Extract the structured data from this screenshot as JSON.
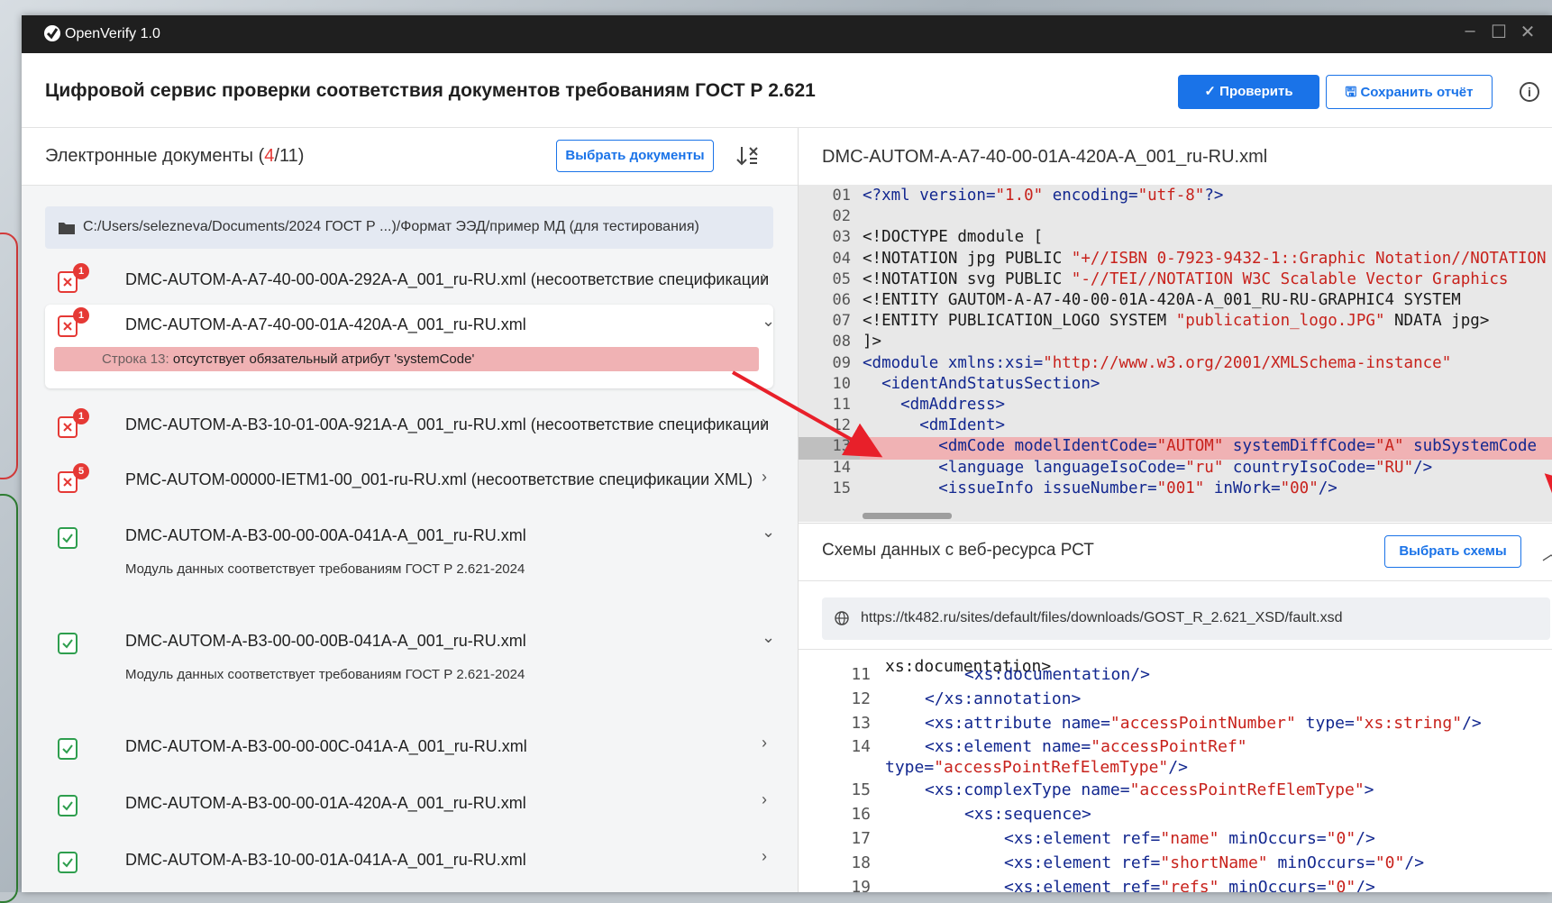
{
  "window": {
    "app_title": "OpenVerify 1.0",
    "controls": [
      "–",
      "☐",
      "✕"
    ]
  },
  "header": {
    "title": "Цифровой сервис проверки соответствия документов требованиям ГОСТ Р 2.621",
    "check_button": "Проверить",
    "save_button": "Сохранить отчёт",
    "info_icon": "i"
  },
  "documents_panel": {
    "title": "Электронные документы",
    "count_open": "(",
    "count_error": "4",
    "count_total": "/11)",
    "select_button": "Выбрать документы",
    "path": "C:/Users/selezneva/Documents/2024 ГОСТ Р ...)/Формат ЭЭД/пример МД (для тестирования)",
    "items": [
      {
        "status": "error",
        "badge": "1",
        "name": "DMC-AUTOM-A-A7-40-00-00A-292A-A_001_ru-RU.xml (несоответствие спецификации",
        "chevron": "›"
      },
      {
        "status": "error",
        "badge": "1",
        "name": "DMC-AUTOM-A-A7-40-00-01A-420A-A_001_ru-RU.xml",
        "chevron": "⌄",
        "error_label": "Строка 13:",
        "error_text": "отсутствует обязательный атрибут 'systemCode'"
      },
      {
        "status": "error",
        "badge": "1",
        "name": "DMC-AUTOM-A-B3-10-01-00A-921A-A_001_ru-RU.xml (несоответствие спецификации",
        "chevron": "›"
      },
      {
        "status": "error",
        "badge": "5",
        "name": "PMC-AUTOM-00000-IETM1-00_001-ru-RU.xml (несоответствие спецификации XML)",
        "chevron": "›"
      },
      {
        "status": "ok",
        "name": "DMC-AUTOM-A-B3-00-00-00A-041A-A_001_ru-RU.xml",
        "chevron": "⌄",
        "sub": "Модуль данных соответствует требованиям ГОСТ Р 2.621-2024"
      },
      {
        "status": "ok",
        "name": "DMC-AUTOM-A-B3-00-00-00B-041A-A_001_ru-RU.xml",
        "chevron": "⌄",
        "sub": "Модуль данных соответствует требованиям ГОСТ Р 2.621-2024"
      },
      {
        "status": "ok",
        "name": "DMC-AUTOM-A-B3-00-00-00C-041A-A_001_ru-RU.xml",
        "chevron": "›"
      },
      {
        "status": "ok",
        "name": "DMC-AUTOM-A-B3-00-00-01A-420A-A_001_ru-RU.xml",
        "chevron": "›"
      },
      {
        "status": "ok",
        "name": "DMC-AUTOM-A-B3-10-00-01A-041A-A_001_ru-RU.xml",
        "chevron": "›"
      }
    ]
  },
  "viewer": {
    "file_name": "DMC-AUTOM-A-A7-40-00-01A-420A-A_001_ru-RU.xml",
    "highlighted_line": "13",
    "lines": [
      {
        "n": "01",
        "parts": [
          [
            "tag",
            "<?xml "
          ],
          [
            "attr",
            "version="
          ],
          [
            "val",
            "\"1.0\""
          ],
          [
            "attr",
            " encoding="
          ],
          [
            "val",
            "\"utf-8\""
          ],
          [
            "tag",
            "?>"
          ]
        ]
      },
      {
        "n": "02",
        "parts": []
      },
      {
        "n": "03",
        "parts": [
          [
            "kw",
            "<!DOCTYPE dmodule ["
          ]
        ]
      },
      {
        "n": "04",
        "parts": [
          [
            "kw",
            "<!NOTATION jpg PUBLIC "
          ],
          [
            "val",
            "\"+//ISBN 0-7923-9432-1::Graphic Notation//NOTATION"
          ]
        ]
      },
      {
        "n": "05",
        "parts": [
          [
            "kw",
            "<!NOTATION svg PUBLIC "
          ],
          [
            "val",
            "\"-//TEI//NOTATION W3C Scalable Vector Graphics"
          ]
        ]
      },
      {
        "n": "06",
        "parts": [
          [
            "kw",
            "<!ENTITY GAUTOM-A-A7-40-00-01A-420A-A_001_RU-RU-GRAPHIC4 SYSTEM"
          ]
        ]
      },
      {
        "n": "07",
        "parts": [
          [
            "kw",
            "<!ENTITY PUBLICATION_LOGO SYSTEM "
          ],
          [
            "val",
            "\"publication_logo.JPG\""
          ],
          [
            "kw",
            " NDATA jpg>"
          ]
        ]
      },
      {
        "n": "08",
        "parts": [
          [
            "kw",
            "]>"
          ]
        ]
      },
      {
        "n": "09",
        "parts": [
          [
            "tag",
            "<dmodule "
          ],
          [
            "attr",
            "xmlns:xsi="
          ],
          [
            "val",
            "\"http://www.w3.org/2001/XMLSchema-instance\""
          ]
        ]
      },
      {
        "n": "10",
        "parts": [
          [
            "tag",
            "  <identAndStatusSection>"
          ]
        ]
      },
      {
        "n": "11",
        "parts": [
          [
            "tag",
            "    <dmAddress>"
          ]
        ]
      },
      {
        "n": "12",
        "parts": [
          [
            "tag",
            "      <dmIdent>"
          ]
        ]
      },
      {
        "n": "13",
        "parts": [
          [
            "tag",
            "        <dmCode "
          ],
          [
            "attr",
            "modelIdentCode="
          ],
          [
            "val",
            "\"AUTOM\""
          ],
          [
            "attr",
            " systemDiffCode="
          ],
          [
            "val",
            "\"A\""
          ],
          [
            "attr",
            " subSystemCode"
          ]
        ]
      },
      {
        "n": "14",
        "parts": [
          [
            "tag",
            "        <language "
          ],
          [
            "attr",
            "languageIsoCode="
          ],
          [
            "val",
            "\"ru\""
          ],
          [
            "attr",
            " countryIsoCode="
          ],
          [
            "val",
            "\"RU\""
          ],
          [
            "tag",
            "/>"
          ]
        ]
      },
      {
        "n": "15",
        "parts": [
          [
            "tag",
            "        <issueInfo "
          ],
          [
            "attr",
            "issueNumber="
          ],
          [
            "val",
            "\"001\""
          ],
          [
            "attr",
            " inWork="
          ],
          [
            "val",
            "\"00\""
          ],
          [
            "tag",
            "/>"
          ]
        ]
      }
    ]
  },
  "schemas_panel": {
    "title": "Схемы данных с веб-ресурса РСТ",
    "select_button": "Выбрать схемы",
    "collapse_icon": "︿",
    "url": "https://tk482.ru/sites/default/files/downloads/GOST_R_2.621_XSD/fault.xsd",
    "partial_top": "xs:documentation>",
    "lines": [
      {
        "n": "11",
        "indent": 8,
        "parts": [
          [
            "tag",
            "<xs:documentation/>"
          ]
        ]
      },
      {
        "n": "12",
        "indent": 4,
        "parts": [
          [
            "tag",
            "</xs:annotation>"
          ]
        ]
      },
      {
        "n": "13",
        "indent": 4,
        "parts": [
          [
            "tag",
            "<xs:attribute "
          ],
          [
            "attr",
            "name="
          ],
          [
            "val",
            "\"accessPointNumber\""
          ],
          [
            "attr",
            " type="
          ],
          [
            "val",
            "\"xs:string\""
          ],
          [
            "tag",
            "/>"
          ]
        ]
      },
      {
        "n": "14",
        "indent": 4,
        "parts": [
          [
            "tag",
            "<xs:element "
          ],
          [
            "attr",
            "name="
          ],
          [
            "val",
            "\"accessPointRef\""
          ]
        ]
      },
      {
        "n": "",
        "indent": 0,
        "parts": [
          [
            "attr",
            "type="
          ],
          [
            "val",
            "\"accessPointRefElemType\""
          ],
          [
            "tag",
            "/>"
          ]
        ]
      },
      {
        "n": "15",
        "indent": 4,
        "parts": [
          [
            "tag",
            "<xs:complexType "
          ],
          [
            "attr",
            "name="
          ],
          [
            "val",
            "\"accessPointRefElemType\""
          ],
          [
            "tag",
            ">"
          ]
        ]
      },
      {
        "n": "16",
        "indent": 8,
        "parts": [
          [
            "tag",
            "<xs:sequence>"
          ]
        ]
      },
      {
        "n": "17",
        "indent": 12,
        "parts": [
          [
            "tag",
            "<xs:element "
          ],
          [
            "attr",
            "ref="
          ],
          [
            "val",
            "\"name\""
          ],
          [
            "attr",
            " minOccurs="
          ],
          [
            "val",
            "\"0\""
          ],
          [
            "tag",
            "/>"
          ]
        ]
      },
      {
        "n": "18",
        "indent": 12,
        "parts": [
          [
            "tag",
            "<xs:element "
          ],
          [
            "attr",
            "ref="
          ],
          [
            "val",
            "\"shortName\""
          ],
          [
            "attr",
            " minOccurs="
          ],
          [
            "val",
            "\"0\""
          ],
          [
            "tag",
            "/>"
          ]
        ]
      },
      {
        "n": "19",
        "indent": 12,
        "parts": [
          [
            "tag",
            "<xs:element "
          ],
          [
            "attr",
            "ref="
          ],
          [
            "val",
            "\"refs\""
          ],
          [
            "attr",
            " minOccurs="
          ],
          [
            "val",
            "\"0\""
          ],
          [
            "tag",
            "/>"
          ]
        ]
      }
    ]
  },
  "colors": {
    "accent": "#1a73e8",
    "error": "#e53935",
    "ok": "#2e9e4e",
    "error_highlight": "#f0b2b4",
    "annotation_arrow": "#e8202a"
  }
}
